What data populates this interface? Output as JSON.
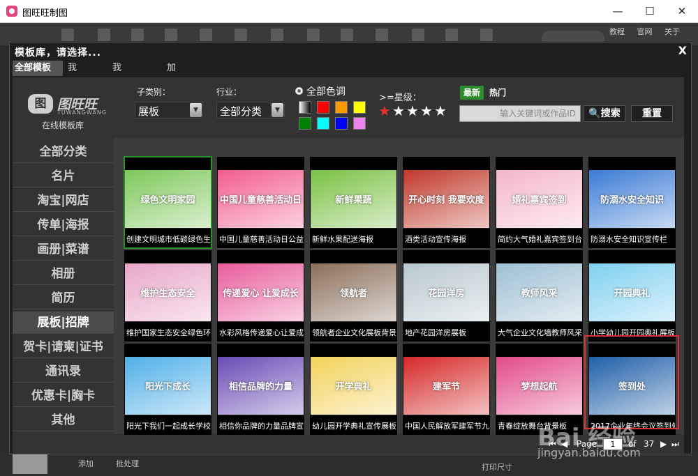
{
  "window": {
    "title": "图旺旺制图",
    "min": "—",
    "max": "☐",
    "close": "✕"
  },
  "top_links": [
    "教程",
    "官网",
    "关于"
  ],
  "bottom": {
    "add": "添加",
    "batch": "批处理",
    "print_size": "打印尺寸"
  },
  "dialog": {
    "title": "模板库，请选择...",
    "close": "X",
    "tabs": [
      "全部模板",
      "我的作品",
      "我的收藏夹",
      "加载过的模板"
    ],
    "active_tab": 0
  },
  "brand": {
    "mark": "图",
    "name": "图旺旺",
    "en": "TUWANGWANG",
    "sub": "在线模板库"
  },
  "categories": [
    "全部分类",
    "名片",
    "淘宝|网店",
    "传单|海报",
    "画册|菜谱",
    "相册",
    "简历",
    "展板|招牌",
    "贺卡|请柬|证书",
    "通讯录",
    "优惠卡|胸卡",
    "其他"
  ],
  "active_category": 7,
  "filters": {
    "subtype_label": "子类别：",
    "subtype_value": "展板",
    "industry_label": "行业：",
    "industry_value": "全部分类",
    "color_label": "全部色调",
    "star_label": ">=星级：",
    "stars": [
      "★",
      "★",
      "★",
      "★",
      "★"
    ],
    "newest": "最新",
    "hot": "热门",
    "search_placeholder": "输入关键词或作品ID",
    "search_btn": "搜索",
    "reset_btn": "重置",
    "swatch_colors": [
      "#ff0000",
      "#ff9900",
      "#ffff00",
      "#008000",
      "#00ffff",
      "#0000ff",
      "#ee82ee"
    ]
  },
  "templates": [
    {
      "title": "创建文明城市低碳绿色生",
      "thumb_text": "绿色文明家园",
      "bg": "#7ec85a"
    },
    {
      "title": "中国儿童慈善活动日公益",
      "thumb_text": "中国儿童慈善活动日",
      "bg": "#f25d8e"
    },
    {
      "title": "新鲜水果配送海报",
      "thumb_text": "新鲜果蔬",
      "bg": "#7ac143"
    },
    {
      "title": "酒类活动宣传海报",
      "thumb_text": "开心时刻 我要欢度",
      "bg": "#c0392b"
    },
    {
      "title": "简约大气婚礼嘉宾签到台",
      "thumb_text": "婚礼嘉宾签到",
      "bg": "#f4b6c9"
    },
    {
      "title": "防溺水安全知识宣传栏",
      "thumb_text": "防溺水安全知识",
      "bg": "#3a7bd5"
    },
    {
      "title": "维护国家生态安全绿色环",
      "thumb_text": "维护生态安全",
      "bg": "#e8a7c9"
    },
    {
      "title": "水彩风格传递爱心让爱成",
      "thumb_text": "传递爱心 让爱成长",
      "bg": "#e85d9c"
    },
    {
      "title": "领航者企业文化展板背景",
      "thumb_text": "领航者",
      "bg": "#8b6f5a"
    },
    {
      "title": "地产花园洋房展板",
      "thumb_text": "花园洋房",
      "bg": "#b8c8d0"
    },
    {
      "title": "大气企业文化墙教师风采",
      "thumb_text": "教师风采",
      "bg": "#9dbfd3"
    },
    {
      "title": "小学幼儿园开园典礼展板",
      "thumb_text": "开园典礼",
      "bg": "#7fd0f0"
    },
    {
      "title": "阳光下我们一起成长学校",
      "thumb_text": "阳光下成长",
      "bg": "#4fb0e8"
    },
    {
      "title": "相信你品牌的力量品牌宣",
      "thumb_text": "相信品牌的力量",
      "bg": "#6a4bb5"
    },
    {
      "title": "幼儿园开学典礼宣传展板",
      "thumb_text": "开学典礼",
      "bg": "#f2d25a"
    },
    {
      "title": "中国人民解放军建军节九",
      "thumb_text": "建军节",
      "bg": "#d62828"
    },
    {
      "title": "青春绽放舞台背景板",
      "thumb_text": "梦想起航",
      "bg": "#e24a8a"
    },
    {
      "title": "2017企业年终会议签到处",
      "thumb_text": "签到处",
      "bg": "#1f5fa8"
    }
  ],
  "pager": {
    "prev_first": "⏮",
    "prev": "◀",
    "label": "Page",
    "current": "1",
    "of": "of",
    "total": "37",
    "next": "▶",
    "last": "⏭"
  },
  "watermark": {
    "brand": "Bai 经验",
    "url": "jingyan.baidu.com"
  }
}
